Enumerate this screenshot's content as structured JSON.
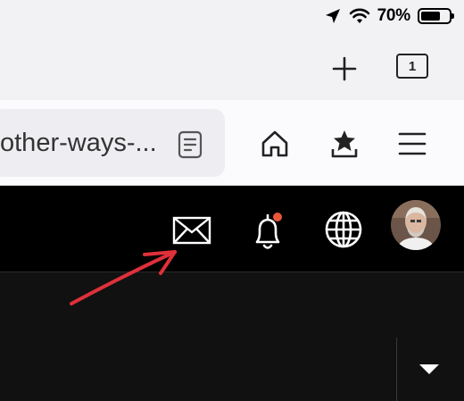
{
  "status_bar": {
    "battery_percent": "70%",
    "battery_level": 0.7,
    "icons": [
      "location-arrow-icon",
      "wifi-icon",
      "battery-icon"
    ]
  },
  "tabs": {
    "tab_count": "1",
    "new_tab_icon": "plus-icon"
  },
  "toolbar": {
    "url_text": "other-ways-...",
    "icons": [
      "reader-mode-icon",
      "home-icon",
      "bookmark-star-icon",
      "menu-icon"
    ]
  },
  "site_header": {
    "icons": [
      "mail-icon",
      "bell-icon",
      "globe-icon",
      "avatar"
    ],
    "has_notification_dot": true,
    "notification_color": "#e8563a"
  },
  "annotation": {
    "arrow_color": "#e0303a",
    "points_to": "mail-icon"
  }
}
